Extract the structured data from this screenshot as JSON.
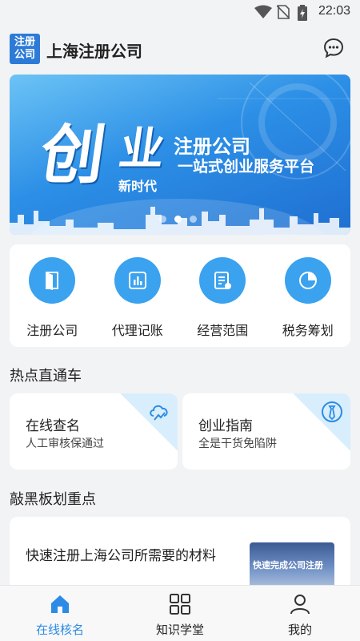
{
  "status_bar": {
    "time": "22:03",
    "icons": [
      "wifi-icon",
      "no-sim-icon",
      "battery-charging-icon"
    ]
  },
  "app_bar": {
    "logo_line1": "注册",
    "logo_line2": "公司",
    "title": "上海注册公司",
    "action_icon": "chat-bubble-icon"
  },
  "banner": {
    "headline_char1": "创",
    "headline_char2": "业",
    "sub_title": "注册公司",
    "sub_tagline": "一站式创业服务平台",
    "sub_era": "新时代",
    "page_count": 3,
    "active_page": 2
  },
  "services": [
    {
      "label": "注册公司",
      "icon": "door-icon"
    },
    {
      "label": "代理记账",
      "icon": "bar-chart-icon"
    },
    {
      "label": "经营范围",
      "icon": "document-edit-icon"
    },
    {
      "label": "税务筹划",
      "icon": "pie-chart-icon"
    }
  ],
  "hot_section": {
    "title": "热点直通车",
    "cards": [
      {
        "title": "在线查名",
        "desc": "人工审核保通过",
        "icon": "cloud-chart-icon"
      },
      {
        "title": "创业指南",
        "desc": "全是干货免陷阱",
        "icon": "tie-badge-icon"
      }
    ]
  },
  "key_section": {
    "title": "敲黑板划重点",
    "article": {
      "title": "快速注册上海公司所需要的材料",
      "thumb_text": "快速完成公司注册"
    }
  },
  "tab_bar": {
    "tabs": [
      {
        "label": "在线核名",
        "icon": "home-icon",
        "active": true
      },
      {
        "label": "知识学堂",
        "icon": "grid-icon",
        "active": false
      },
      {
        "label": "我的",
        "icon": "person-icon",
        "active": false
      }
    ]
  },
  "colors": {
    "accent": "#2b8be6",
    "icon_circle": "#3aa2ef",
    "background": "#f2f3f5"
  }
}
